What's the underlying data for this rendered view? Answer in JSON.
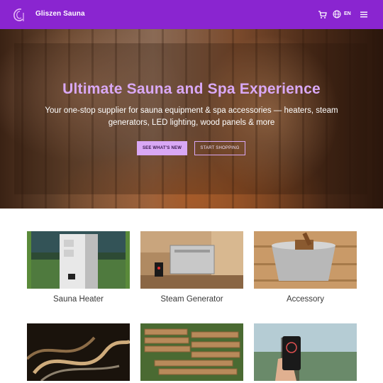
{
  "header": {
    "brand": "Gliszen Sauna",
    "language": "EN",
    "icons": [
      "logo-icon",
      "cart-icon",
      "globe-icon",
      "menu-icon"
    ],
    "background_color": "#8a25d0"
  },
  "hero": {
    "title": "Ultimate Sauna and Spa Experience",
    "subtitle": "Your one-stop supplier for sauna equipment & spa accessories — heaters, steam generators, LED lighting, wood panels & more",
    "primary_button": "SEE WHAT'S NEW",
    "secondary_button": "START SHOPPING",
    "accent_color": "#d9a8f5"
  },
  "products": [
    {
      "label": "Sauna Heater"
    },
    {
      "label": "Steam Generator"
    },
    {
      "label": "Accessory"
    },
    {
      "label": ""
    },
    {
      "label": ""
    },
    {
      "label": ""
    }
  ]
}
